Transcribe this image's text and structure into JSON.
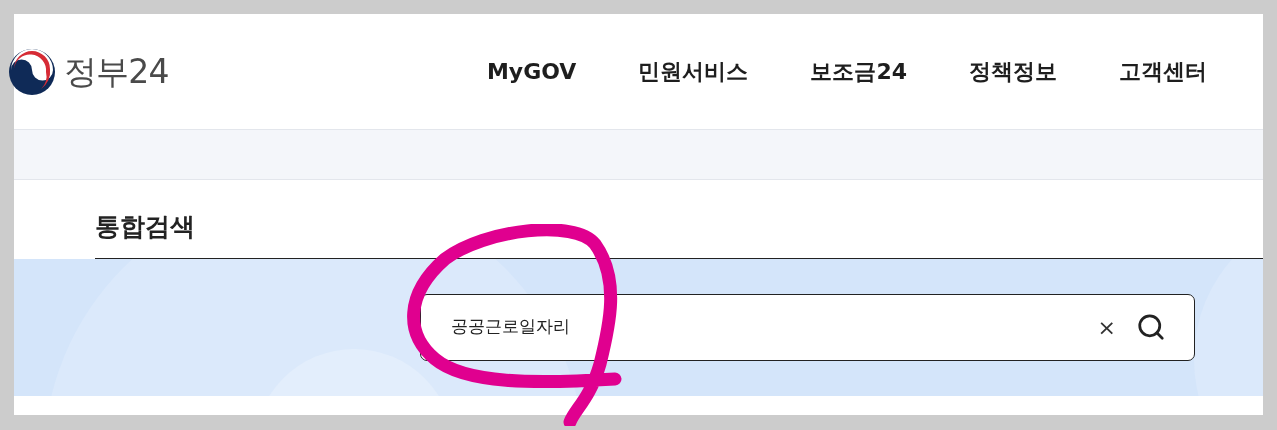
{
  "header": {
    "logo_text": "정부24",
    "nav": [
      {
        "label": "MyGOV"
      },
      {
        "label": "민원서비스"
      },
      {
        "label": "보조금24"
      },
      {
        "label": "정책정보"
      },
      {
        "label": "고객센터"
      }
    ]
  },
  "search": {
    "title": "통합검색",
    "value": "공공근로일자리",
    "clear": "×"
  }
}
